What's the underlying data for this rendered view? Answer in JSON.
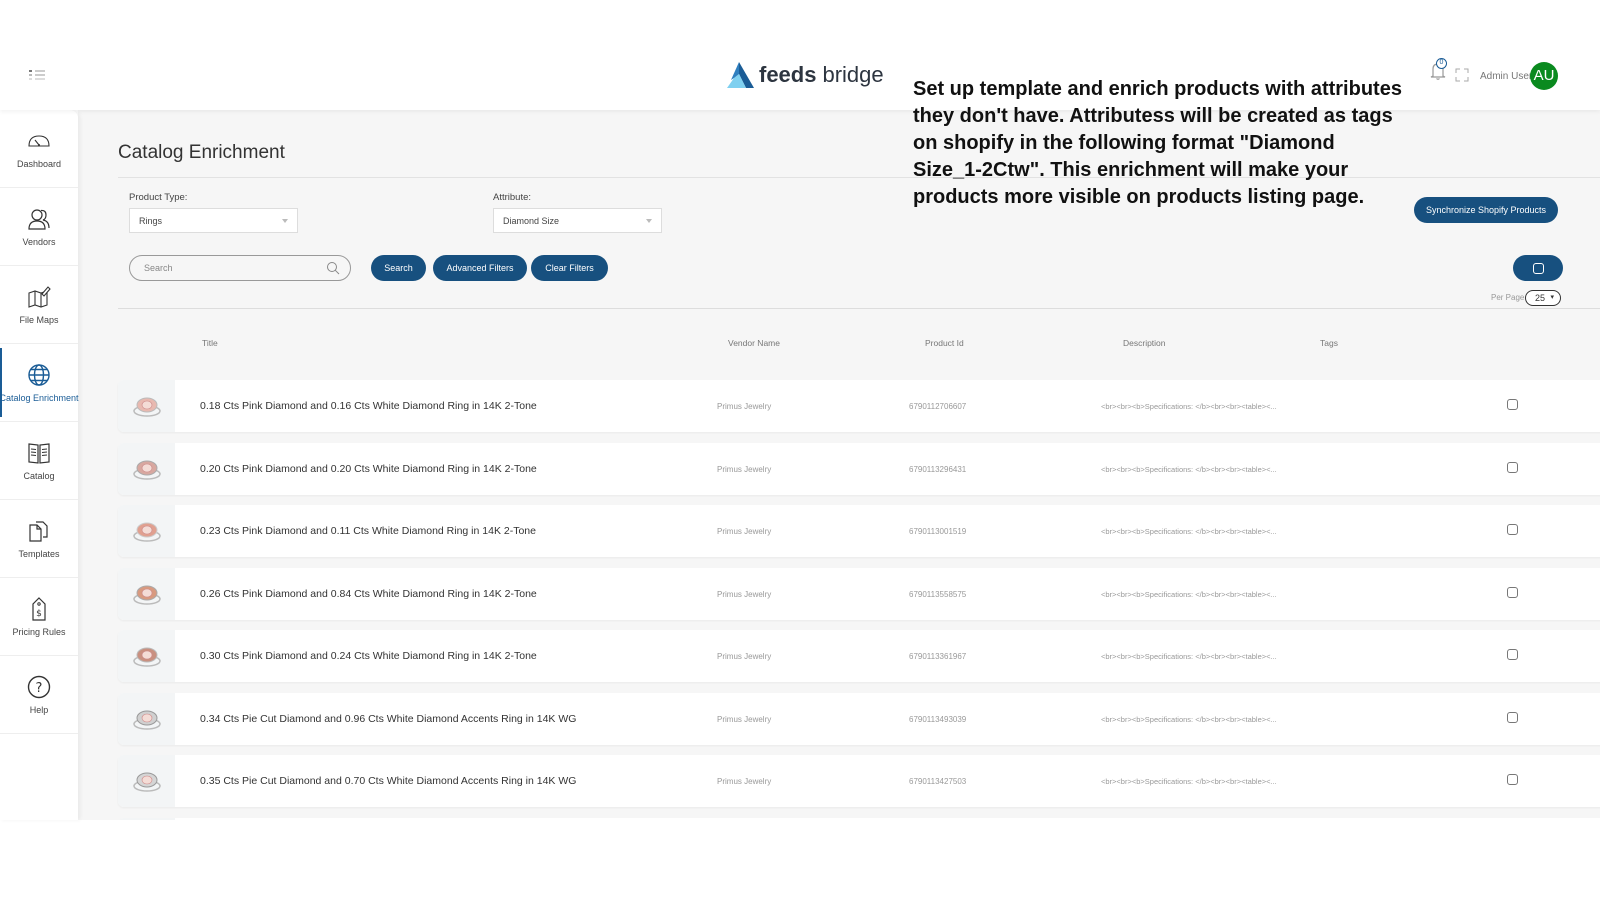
{
  "header": {
    "brand_bold": "feeds",
    "brand_light": "bridge",
    "notification_count": "0",
    "user_name": "Admin User",
    "user_initials": "AU",
    "avatar_color": "#0a8a1f"
  },
  "sidebar": {
    "items": [
      {
        "label": "Dashboard",
        "icon": "gauge-icon"
      },
      {
        "label": "Vendors",
        "icon": "users-icon"
      },
      {
        "label": "File Maps",
        "icon": "map-icon"
      },
      {
        "label": "Catalog Enrichment",
        "icon": "globe-icon",
        "active": true
      },
      {
        "label": "Catalog",
        "icon": "book-icon"
      },
      {
        "label": "Templates",
        "icon": "files-icon"
      },
      {
        "label": "Pricing Rules",
        "icon": "price-tag-icon"
      },
      {
        "label": "Help",
        "icon": "help-icon"
      }
    ]
  },
  "page": {
    "title": "Catalog Enrichment",
    "product_type_label": "Product Type:",
    "product_type_value": "Rings",
    "attribute_label": "Attribute:",
    "attribute_value": "Diamond Size",
    "search_placeholder": "Search",
    "search_button": "Search",
    "advanced_filters_button": "Advanced Filters",
    "clear_filters_button": "Clear Filters",
    "sync_button": "Synchronize Shopify Products",
    "per_page_label": "Per Page",
    "per_page_value": "25",
    "accent_color": "#17507f"
  },
  "table": {
    "columns": [
      "Title",
      "Vendor Name",
      "Product Id",
      "Description",
      "Tags"
    ],
    "rows": [
      {
        "title": "0.18 Cts Pink Diamond and 0.16 Cts White Diamond Ring in 14K 2-Tone",
        "vendor": "Primus Jewelry",
        "product_id": "6790112706607",
        "description": "<br><br><b>Specifications: </b><br><br><table><..."
      },
      {
        "title": "0.20 Cts Pink Diamond and 0.20 Cts White Diamond Ring in 14K 2-Tone",
        "vendor": "Primus Jewelry",
        "product_id": "6790113296431",
        "description": "<br><br><b>Specifications: </b><br><br><table><..."
      },
      {
        "title": "0.23 Cts Pink Diamond and 0.11 Cts White Diamond Ring in 14K 2-Tone",
        "vendor": "Primus Jewelry",
        "product_id": "6790113001519",
        "description": "<br><br><b>Specifications: </b><br><br><table><..."
      },
      {
        "title": "0.26 Cts Pink Diamond and 0.84 Cts White Diamond Ring in 14K 2-Tone",
        "vendor": "Primus Jewelry",
        "product_id": "6790113558575",
        "description": "<br><br><b>Specifications: </b><br><br><table><..."
      },
      {
        "title": "0.30 Cts Pink Diamond and 0.24 Cts White Diamond Ring in 14K 2-Tone",
        "vendor": "Primus Jewelry",
        "product_id": "6790113361967",
        "description": "<br><br><b>Specifications: </b><br><br><table><..."
      },
      {
        "title": "0.34 Cts Pie Cut Diamond and 0.96 Cts White Diamond Accents Ring in 14K WG",
        "vendor": "Primus Jewelry",
        "product_id": "6790113493039",
        "description": "<br><br><b>Specifications: </b><br><br><table><..."
      },
      {
        "title": "0.35 Cts Pie Cut Diamond and 0.70 Cts White Diamond Accents Ring in 14K WG",
        "vendor": "Primus Jewelry",
        "product_id": "6790113427503",
        "description": "<br><br><b>Specifications: </b><br><br><table><..."
      }
    ]
  },
  "annotation": {
    "text": "Set up template and enrich products with attributes they don't have. Attributess will  be created as tags on shopify in the following format \"Diamond Size_1-2Ctw\". This enrichment will make your products more visible on products listing page."
  }
}
